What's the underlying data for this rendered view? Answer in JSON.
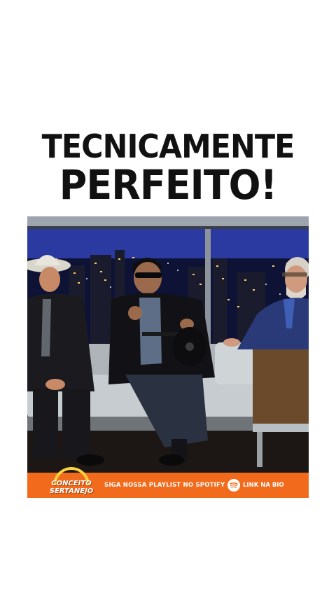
{
  "headline": {
    "line1": "TECNICAMENTE",
    "line2": "PERFEITO!"
  },
  "video": {
    "description_icon": "tv-show-still"
  },
  "banner": {
    "brand_line1": "CONCEITO",
    "brand_line2": "SERTANEJO",
    "cta": "SIGA NOSSA PLAYLIST NO SPOTIFY",
    "spotify_icon": "spotify-icon",
    "link": "LINK NA BIO",
    "color": "#f26a1b"
  }
}
